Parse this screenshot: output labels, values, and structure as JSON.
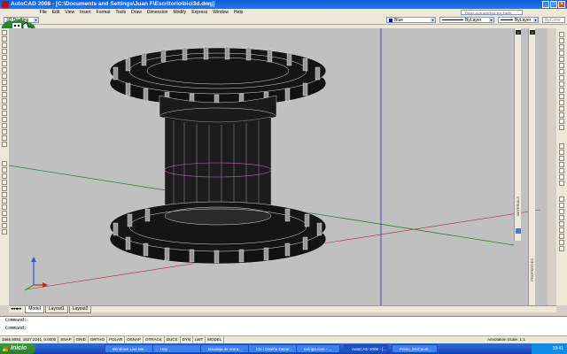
{
  "window": {
    "title": "AutoCAD 2008 - [C:\\Documents and Settings\\Juan F\\Escritorio\\bici3d.dwg]"
  },
  "menu": [
    "File",
    "Edit",
    "View",
    "Insert",
    "Format",
    "Tools",
    "Draw",
    "Dimension",
    "Modify",
    "Express",
    "Window",
    "Help"
  ],
  "toolbar": {
    "workspace": "3D Drafting",
    "search_placeholder": "Type a question for help",
    "color": "Blue",
    "linetype": "ByLayer",
    "lineweight": "ByLayer",
    "plotstyle": "ByColor"
  },
  "palettes": {
    "left_label": "MATERIALS",
    "right_label": "PROPERTIES"
  },
  "layout_tabs": [
    "Model",
    "Layout1",
    "Layout2"
  ],
  "command": {
    "line1": "Command:",
    "line2": "Command:"
  },
  "status": {
    "coords": "1565.9092, 1527.2241, 0.0000",
    "toggles": [
      "SNAP",
      "GRID",
      "ORTHO",
      "POLAR",
      "OSNAP",
      "OTRACK",
      "DUCS",
      "DYN",
      "LWT",
      "MODEL"
    ],
    "annotation": "Annotation Scale: 1:1"
  },
  "taskbar": {
    "start": "Inicio",
    "items": [
      "Windows Live Me...",
      "Hey",
      "Bandeja de entra...",
      "Cle i Diseño Depor...",
      "taringa.com - ...",
      "AutoCAD 2008 - [...",
      "Primo_MoCount..."
    ],
    "clock": "19:41"
  },
  "colors": {
    "viewport_bg": "#c0c0c0",
    "taskbar": "#245edb",
    "start": "#2c7e2c"
  }
}
